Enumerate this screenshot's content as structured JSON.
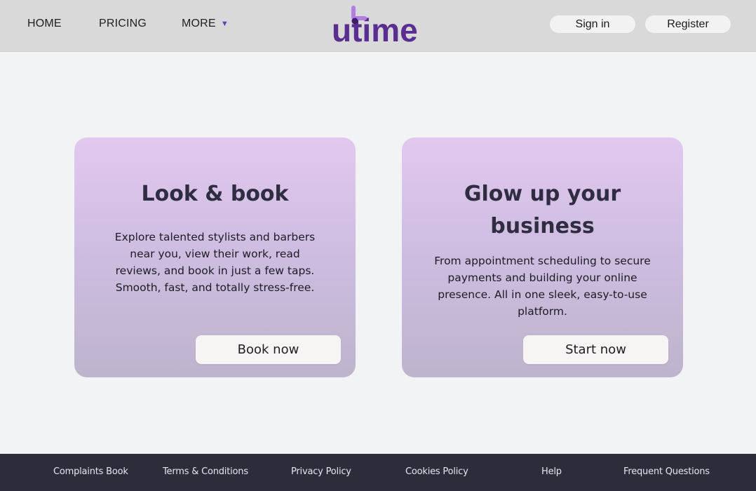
{
  "header": {
    "nav": [
      {
        "label": "HOME"
      },
      {
        "label": "PRICING"
      },
      {
        "label": "MORE"
      }
    ],
    "more_caret_icon": "caret-down-icon",
    "logo_text": "utime",
    "signin_label": "Sign in",
    "register_label": "Register"
  },
  "cards": [
    {
      "title": "Look & book",
      "text": "Explore talented stylists and barbers near you, view their work, read reviews, and book in just a few taps. Smooth, fast, and totally stress-free.",
      "button": "Book now"
    },
    {
      "title": "Glow up your business",
      "text": "From appointment scheduling to secure payments and building your online presence. All in one sleek, easy-to-use platform.",
      "button": "Start now"
    }
  ],
  "footer": {
    "links": [
      {
        "label": "Complaints Book"
      },
      {
        "label": "Terms & Conditions"
      },
      {
        "label": "Privacy Policy"
      },
      {
        "label": "Cookies Policy"
      },
      {
        "label": "Help"
      },
      {
        "label": "Frequent Questions"
      }
    ]
  },
  "colors": {
    "brand_purple": "#5a2d91",
    "brand_light_purple": "#a36bd6",
    "card_gradient_top": "#e2c8ef",
    "card_gradient_bottom": "#bdb4cd",
    "footer_bg": "#2d2c3b",
    "header_bg": "#d9d9d9"
  }
}
